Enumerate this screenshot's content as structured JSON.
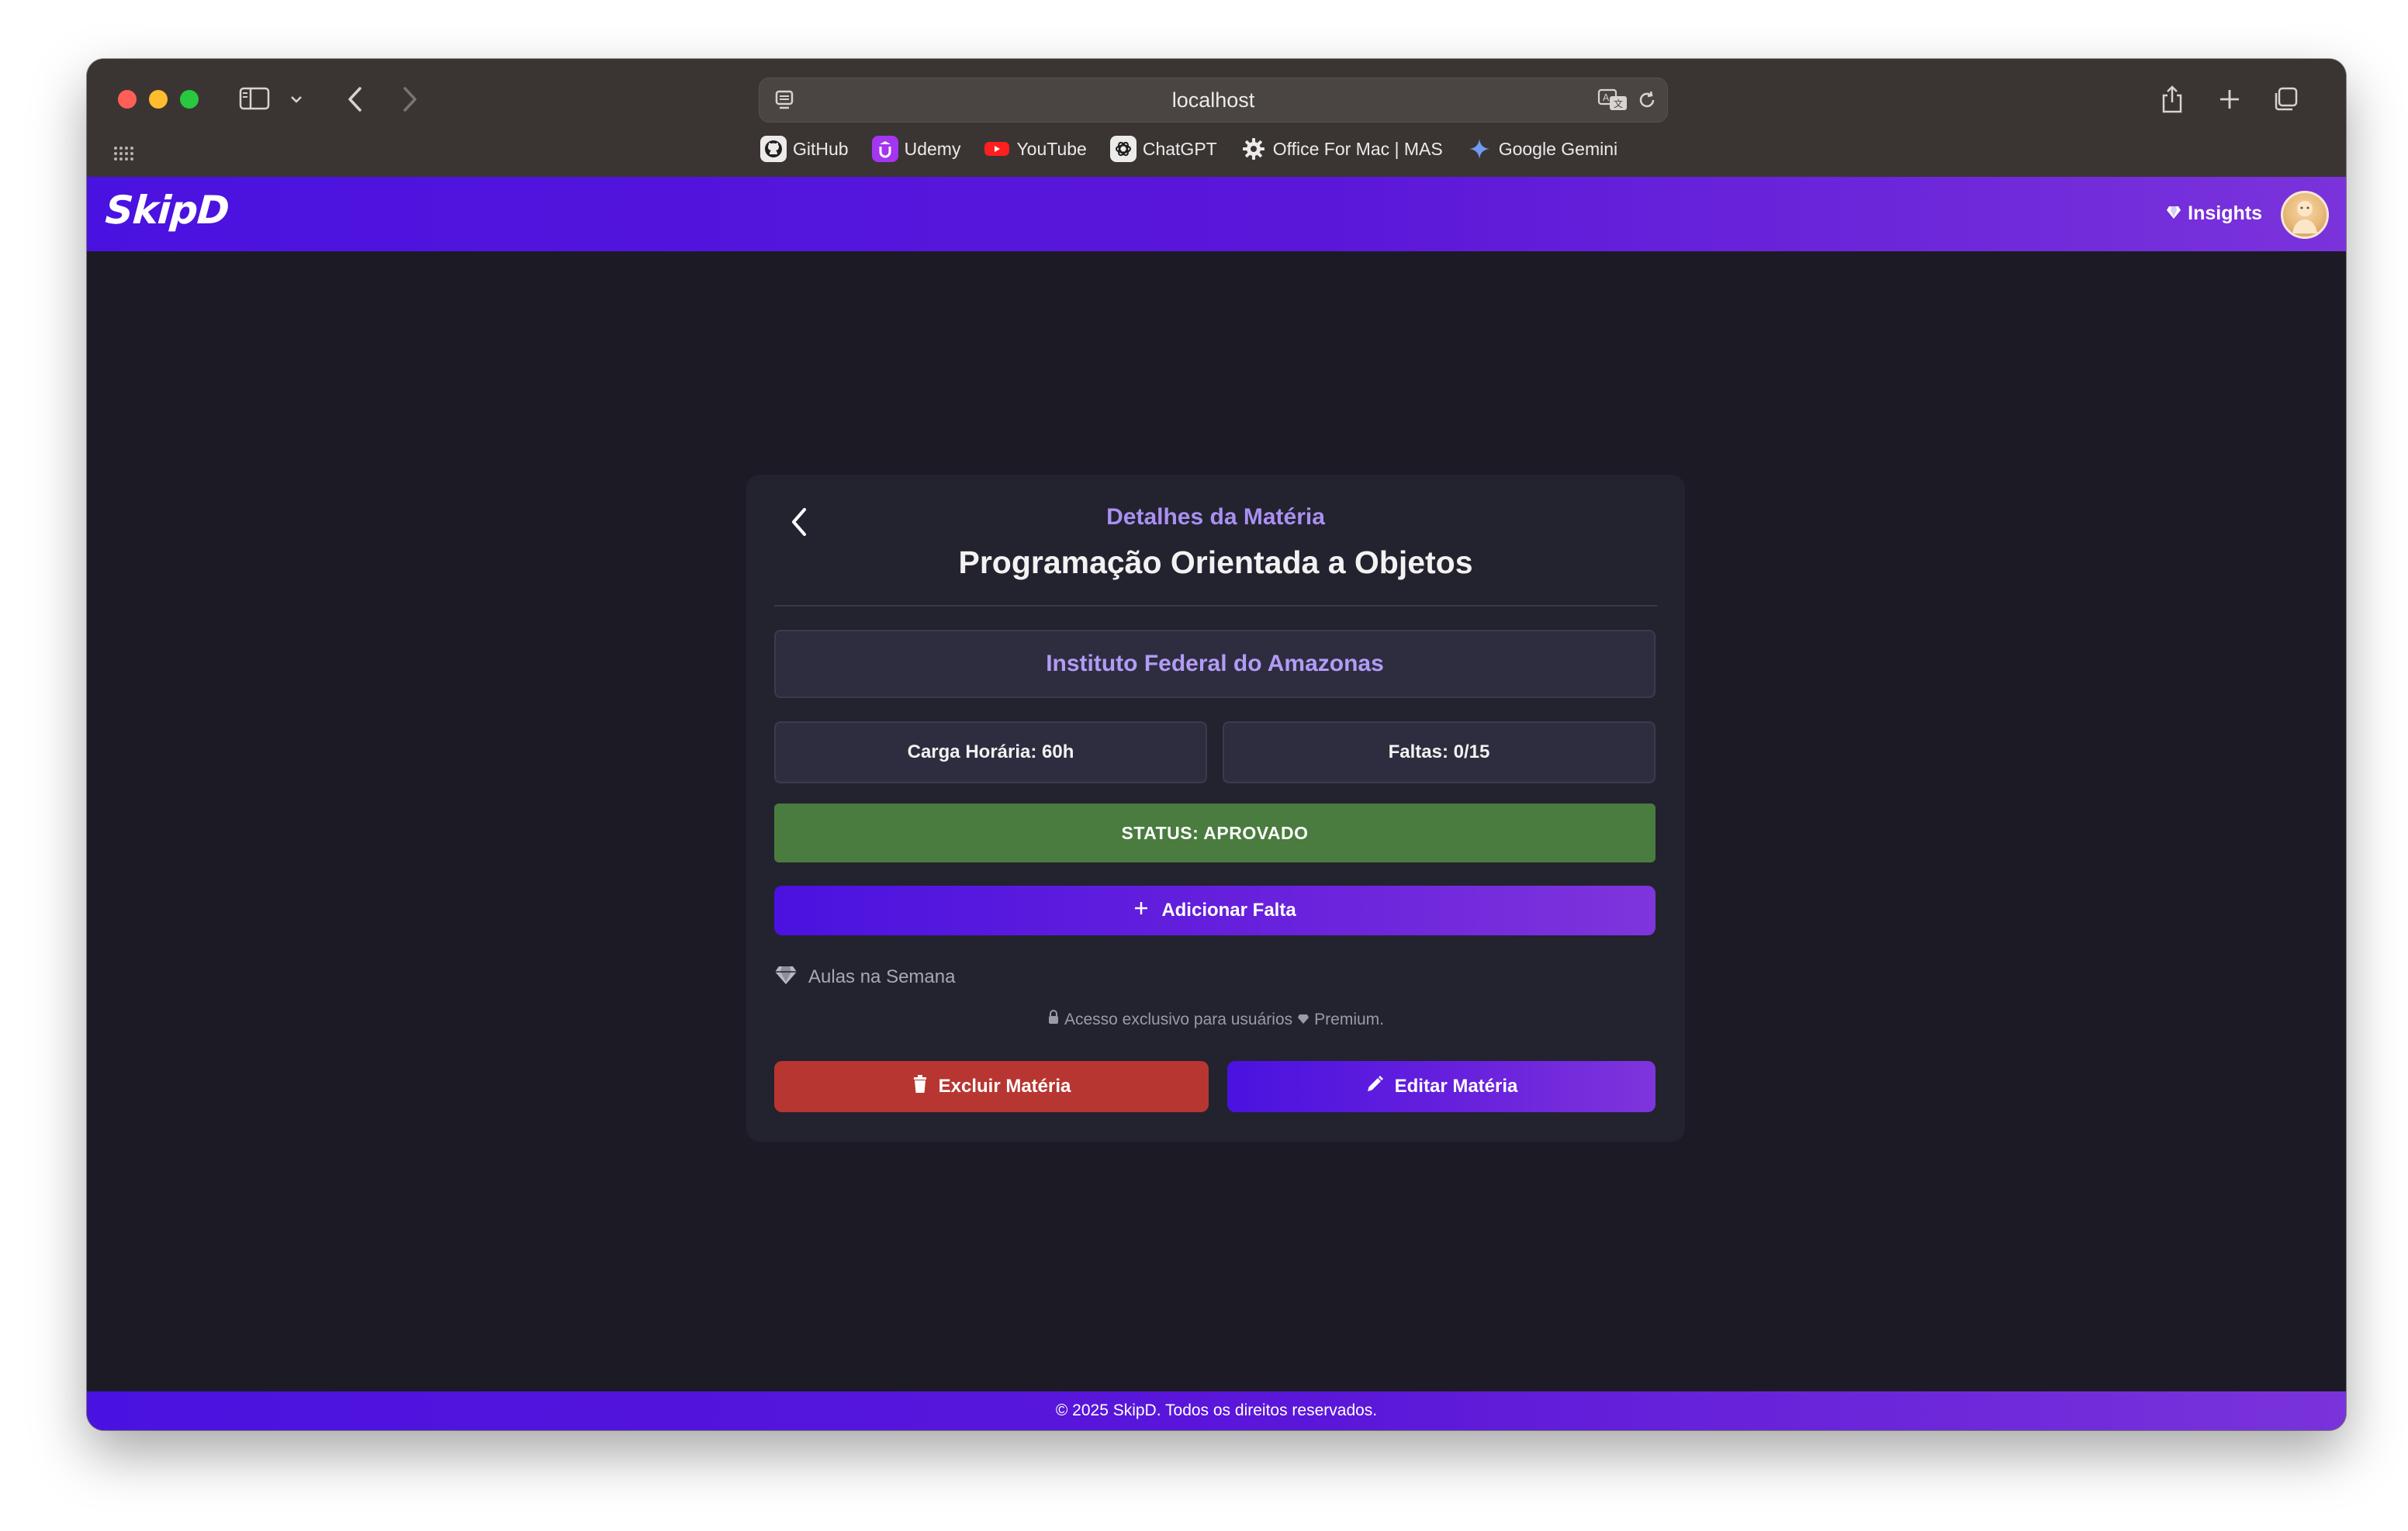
{
  "browser": {
    "url": "localhost",
    "bookmarks": [
      {
        "label": "GitHub",
        "icon": "github-icon"
      },
      {
        "label": "Udemy",
        "icon": "udemy-icon"
      },
      {
        "label": "YouTube",
        "icon": "youtube-icon"
      },
      {
        "label": "ChatGPT",
        "icon": "chatgpt-icon"
      },
      {
        "label": "Office For Mac | MAS",
        "icon": "gear-icon"
      },
      {
        "label": "Google Gemini",
        "icon": "gemini-icon"
      }
    ]
  },
  "header": {
    "logo": "SkipD",
    "insights_label": "Insights"
  },
  "card": {
    "eyebrow": "Detalhes da Matéria",
    "title": "Programação Orientada a Objetos",
    "institution": "Instituto Federal do Amazonas",
    "workload": "Carga Horária: 60h",
    "absences": "Faltas: 0/15",
    "status": "STATUS: APROVADO",
    "add_absence_label": "Adicionar Falta",
    "week_label": "Aulas na Semana",
    "premium_note_prefix": "Acesso exclusivo para usuários",
    "premium_note_suffix": "Premium.",
    "delete_label": "Excluir Matéria",
    "edit_label": "Editar Matéria"
  },
  "footer": {
    "text": "© 2025 SkipD. Todos os direitos reservados."
  },
  "colors": {
    "brand_start": "#4a12e0",
    "brand_end": "#7a33db",
    "status_green": "#497c3e",
    "danger_red": "#b83631",
    "accent_lavender": "#a990f1",
    "background": "#1c1b25",
    "card": "#23222f"
  }
}
